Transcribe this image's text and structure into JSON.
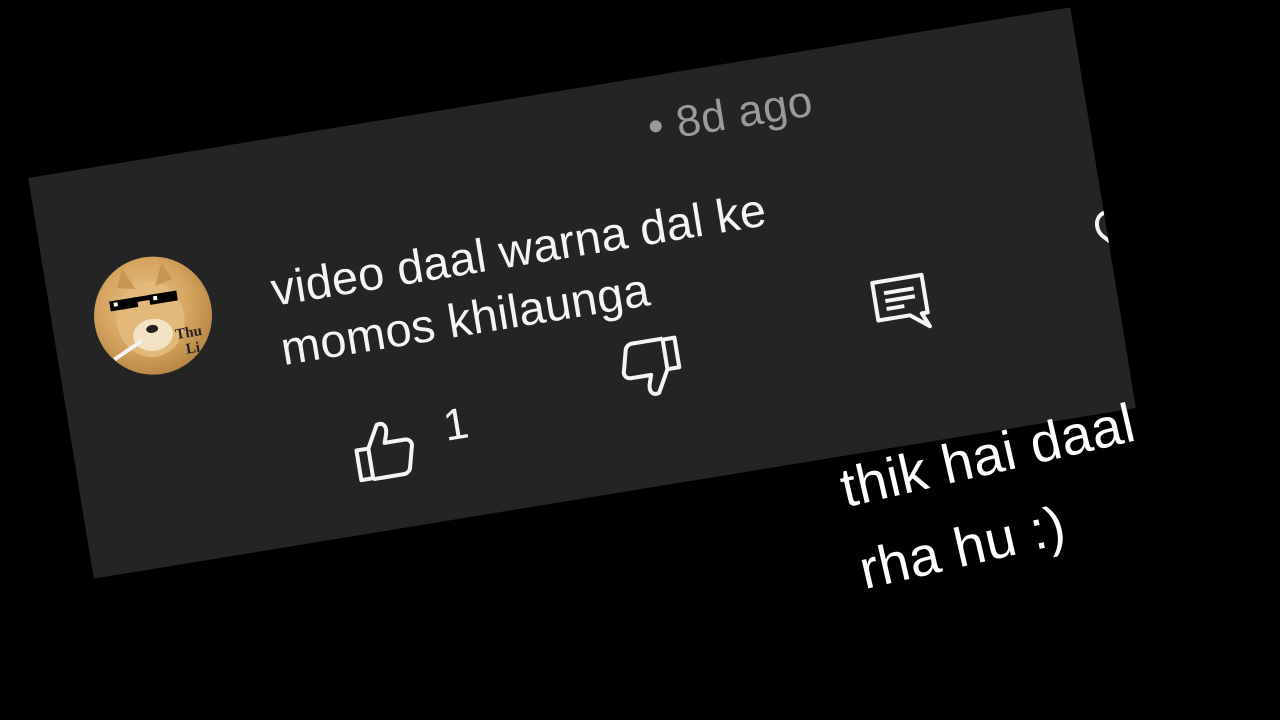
{
  "comment": {
    "timestamp": "• 8d ago",
    "text_line1": "video daal warna dal ke",
    "text_line2": "momos khilaunga",
    "like_count": "1",
    "avatar": {
      "icon": "doge-thug-life-avatar",
      "overlay_text": "Thu",
      "overlay_text2": "Li"
    },
    "icons": [
      "thumbs-up-icon",
      "thumbs-down-icon",
      "reply-icon",
      "heart-icon"
    ]
  },
  "caption": {
    "line1": "thik hai daal",
    "line2": "rha hu :)"
  },
  "colors": {
    "background": "#000000",
    "card": "#242424",
    "text": "#f4f4f4",
    "timestamp": "#9a9a9a"
  }
}
